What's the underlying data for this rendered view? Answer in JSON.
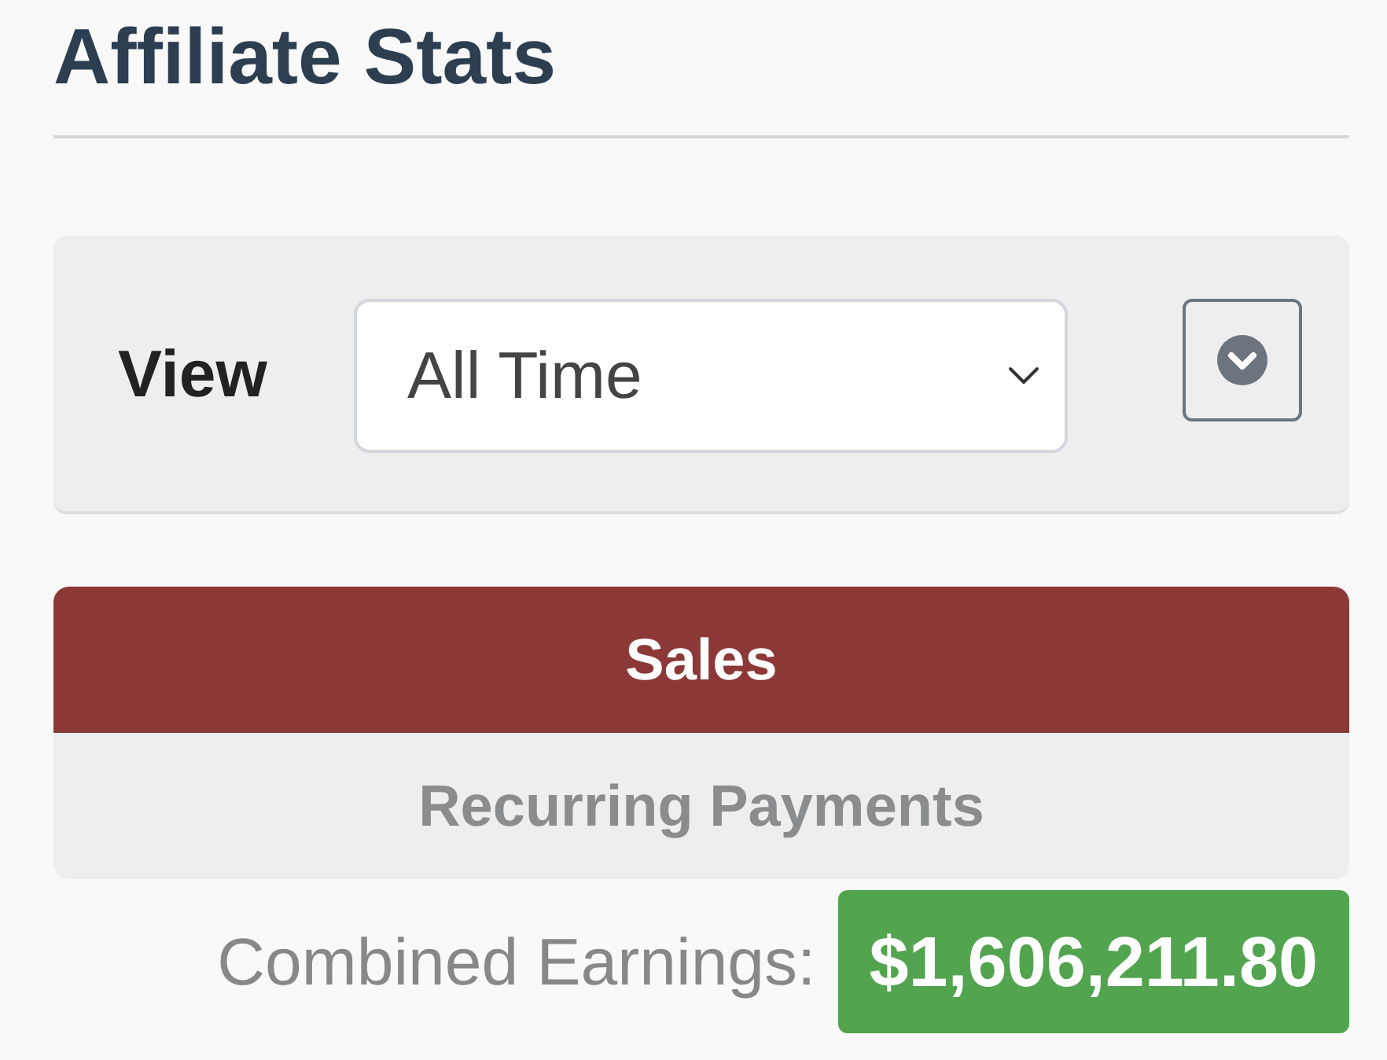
{
  "page": {
    "title": "Affiliate Stats"
  },
  "filter": {
    "label": "View",
    "select": {
      "value": "All Time"
    }
  },
  "tabs": [
    {
      "label": "Sales",
      "selected": true
    },
    {
      "label": "Recurring Payments",
      "selected": false
    }
  ],
  "earnings": {
    "label": "Combined Earnings:",
    "amount": "$1,606,211.80"
  }
}
